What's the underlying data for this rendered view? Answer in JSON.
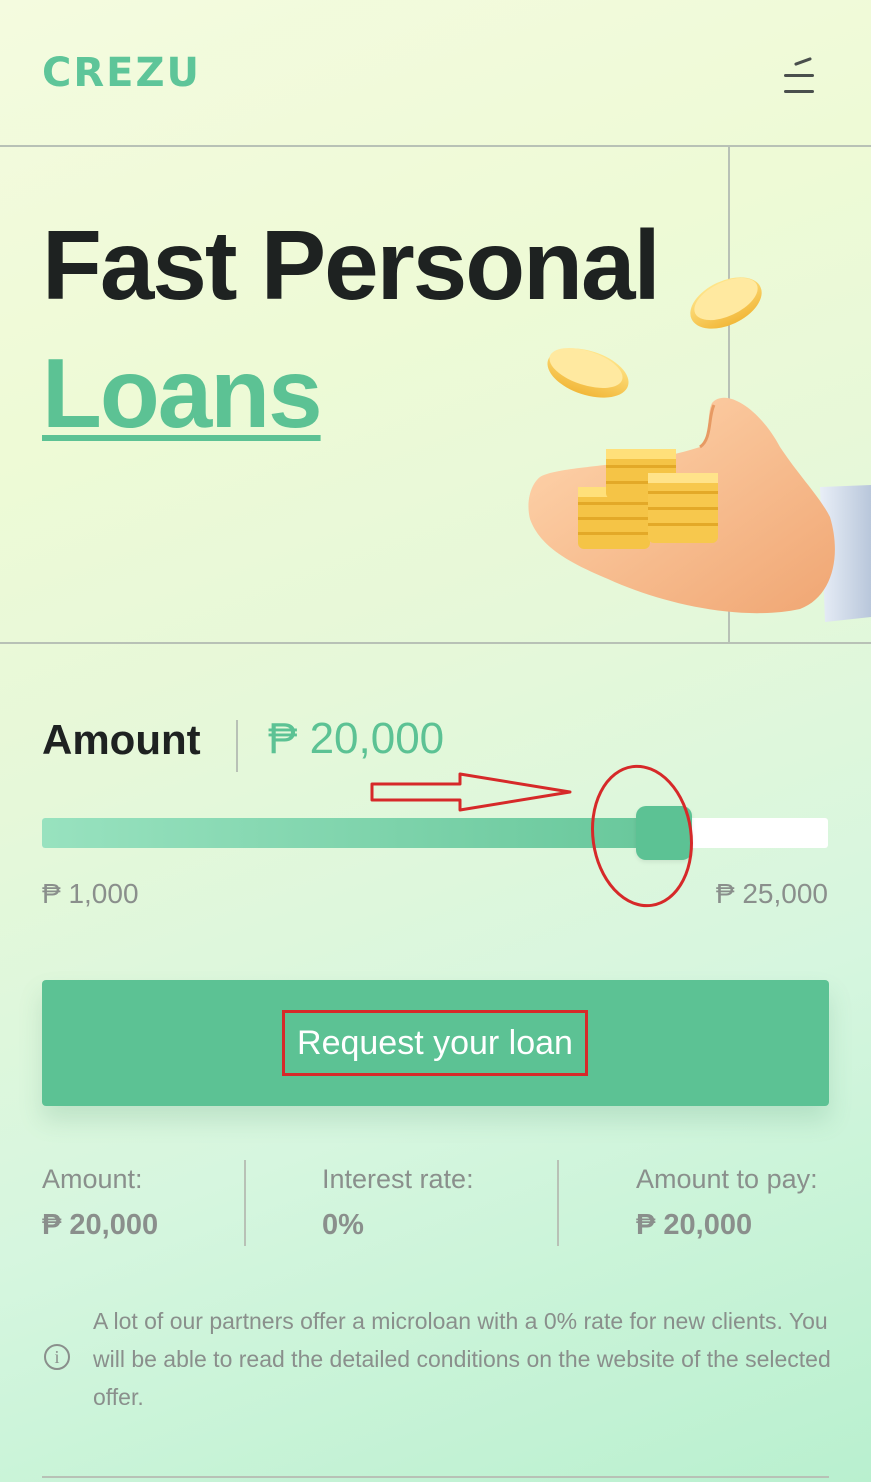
{
  "header": {
    "logo": "CREZU",
    "menu_icon": "hamburger-menu-icon"
  },
  "hero": {
    "title_line1": "Fast Personal",
    "title_line2": "Loans",
    "illustration": "hand-holding-coins-illustration"
  },
  "calculator": {
    "amount_label": "Amount",
    "amount_value": "₱ 20,000",
    "slider": {
      "min_label": "₱ 1,000",
      "max_label": "₱ 25,000",
      "min": 1000,
      "max": 25000,
      "value": 20000
    },
    "request_button_label": "Request your loan"
  },
  "summary": {
    "amount_label": "Amount:",
    "amount_value": "₱ 20,000",
    "interest_label": "Interest rate:",
    "interest_value": "0%",
    "to_pay_label": "Amount to pay:",
    "to_pay_value": "₱ 20,000"
  },
  "info": {
    "icon": "info-icon",
    "text": "A lot of our partners offer a microloan with a 0% rate for new clients. You will be able to read the detailed conditions on the website of the selected offer."
  },
  "colors": {
    "accent": "#5cc294",
    "annotation": "#d62929",
    "text_dark": "#1e2221",
    "text_muted": "#8a8f8c"
  }
}
